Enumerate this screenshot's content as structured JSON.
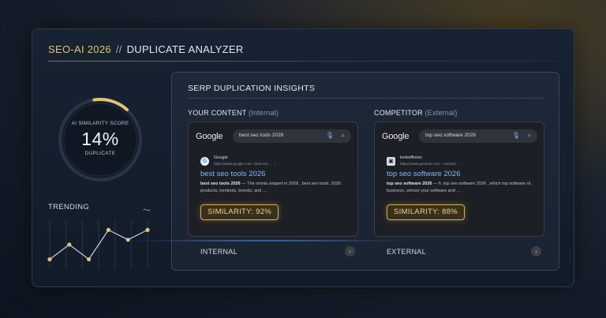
{
  "panel": {
    "title_accent": "SEO-AI 2026",
    "title_sep": "//",
    "title_main": "DUPLICATE ANALYZER"
  },
  "gauge": {
    "title": "AI SIMILARITY SCORE",
    "value": "14%",
    "sub": "DUPLICATE",
    "fraction": 0.14,
    "color": "#e3c07a"
  },
  "trending": {
    "label": "TRENDING",
    "icon": "wave-icon",
    "points": [
      2,
      5,
      2,
      8,
      6,
      8
    ]
  },
  "insights": {
    "title": "SERP DUPLICATION INSIGHTS",
    "left": {
      "heading": "YOUR CONTENT",
      "heading_note": "(Internal)",
      "logo": "Google",
      "query": "best seo tools 2026",
      "favicon": "G",
      "site_name": "Google",
      "site_url": "https://www.google.com › best seo …   ⋮",
      "result_title": "best seo tools 2026",
      "snippet_bold": "best seo tools 2026",
      "snippet_rest": " — The omnia snippet in 2028 , best seo tools. 2026 . products, trentools, brends, and …",
      "similarity": "SIMILARITY: 92%",
      "footer": "INTERNAL"
    },
    "right": {
      "heading": "COMPETITOR",
      "heading_note": "(External)",
      "logo": "Google",
      "query": "top seo software 2026",
      "favicon": "▣",
      "site_name": "lenkeffinion",
      "site_url": "https://www.gomteta.com › concertl…   ⋮",
      "result_title": "top seo software 2026",
      "snippet_bold": "top seo software 2026",
      "snippet_rest": " — fi. top seo software 2026 , which top software of, business, omnoe your software and …",
      "similarity": "SIMILARITY: 88%",
      "footer": "EXTERNAL"
    }
  },
  "colors": {
    "accent": "#e3c07a",
    "link": "#8ab4f8"
  }
}
